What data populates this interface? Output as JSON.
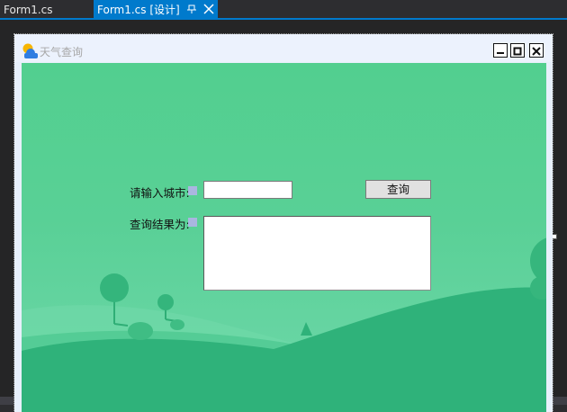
{
  "tabs": [
    {
      "label": "Form1.cs",
      "active": false
    },
    {
      "label": "Form1.cs [设计]",
      "active": true,
      "pin_icon": "pin-icon",
      "close_icon": "close-icon"
    }
  ],
  "colors": {
    "accent": "#007acc",
    "ide_background": "#2d2d30",
    "form_background": "#e8f0fc",
    "scene_green": "#56cf92",
    "hill_green": "#2fb27a"
  },
  "form": {
    "title": "天气查询",
    "title_icon": "weather-icon",
    "window_buttons": [
      "minimize-icon",
      "maximize-icon",
      "close-icon"
    ]
  },
  "city": {
    "label": "请输入城市:",
    "value": "",
    "placeholder": ""
  },
  "query_button": {
    "label": "查询"
  },
  "result": {
    "label": "查询结果为:",
    "value": ""
  }
}
